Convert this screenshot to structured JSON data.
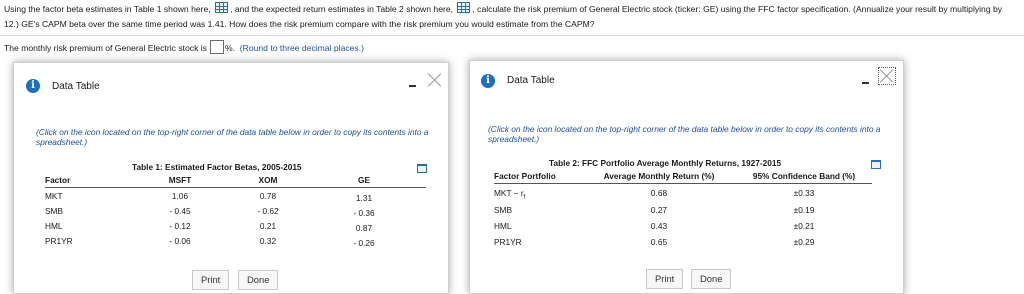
{
  "question": {
    "part1": "Using the factor beta estimates in Table 1 shown here,",
    "part2": ", and the expected return estimates in Table 2 shown here,",
    "part3": ", calculate the risk premium of General Electric stock (ticker: GE) using the FFC factor specification. (Annualize your",
    "part4": "result by multiplying by 12.) GE's CAPM beta over the same time period was 1.41. How does the risk premium compare with the risk premium you would estimate from the CAPM?"
  },
  "answer": {
    "prefix": "The monthly risk premium of General Electric stock is",
    "value": "",
    "suffix": "%.",
    "hint": "(Round to three decimal places.)"
  },
  "dialog1": {
    "title": "Data Table",
    "instructions": "(Click on the icon located on the top-right corner of the data table below in order to copy its contents into a spreadsheet.)",
    "table_title": "Table 1: Estimated Factor Betas, 2005-2015",
    "headers": [
      "Factor",
      "MSFT",
      "XOM",
      "GE"
    ],
    "rows": [
      [
        "MKT",
        "1.06",
        "0.78",
        "1.31"
      ],
      [
        "SMB",
        "- 0.45",
        "- 0.62",
        "- 0.36"
      ],
      [
        "HML",
        "- 0.12",
        "0.21",
        "0.87"
      ],
      [
        "PR1YR",
        "- 0.06",
        "0.32",
        "- 0.26"
      ]
    ],
    "print_label": "Print",
    "done_label": "Done"
  },
  "dialog2": {
    "title": "Data Table",
    "instructions": "(Click on the icon located on the top-right corner of the data table below in order to copy its contents into a spreadsheet.)",
    "table_title": "Table 2: FFC Portfolio Average Monthly Returns, 1927-2015",
    "headers": [
      "Factor Portfolio",
      "Average Monthly Return (%)",
      "95% Confidence Band (%)"
    ],
    "rows": [
      [
        "MKT − r",
        "0.68",
        "±0.33"
      ],
      [
        "SMB",
        "0.27",
        "±0.19"
      ],
      [
        "HML",
        "0.43",
        "±0.21"
      ],
      [
        "PR1YR",
        "0.65",
        "±0.29"
      ]
    ],
    "rf_subscript": "f",
    "print_label": "Print",
    "done_label": "Done"
  },
  "colors": {
    "accent": "#1f6fbf",
    "hint": "#1f4fa3"
  },
  "icons": [
    "table-icon",
    "info-icon",
    "minimize-icon",
    "close-icon",
    "copy-icon"
  ]
}
